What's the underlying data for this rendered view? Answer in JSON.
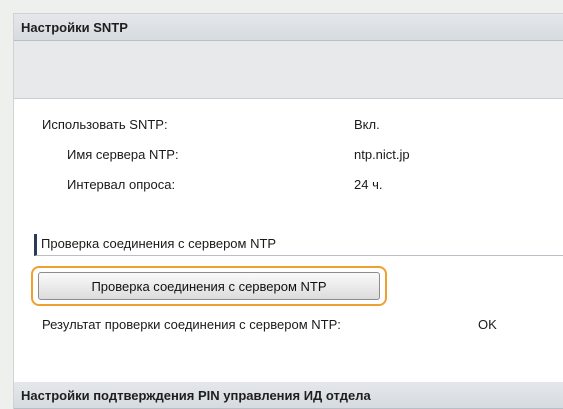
{
  "sntp_section": {
    "title": "Настройки SNTP",
    "rows": [
      {
        "label": "Использовать SNTP:",
        "value": "Вкл."
      },
      {
        "label": "Имя сервера NTP:",
        "value": "ntp.nict.jp"
      },
      {
        "label": "Интервал опроса:",
        "value": "24 ч."
      }
    ]
  },
  "connection_check": {
    "subheader": "Проверка соединения с сервером NTP",
    "button_label": "Проверка соединения с сервером NTP",
    "result_label": "Результат проверки соединения с сервером NTP:",
    "result_value": "OK"
  },
  "pin_section": {
    "title": "Настройки подтверждения PIN управления ИД отдела"
  },
  "colors": {
    "highlight": "#f0a030",
    "subheader_accent": "#2b3a55"
  }
}
